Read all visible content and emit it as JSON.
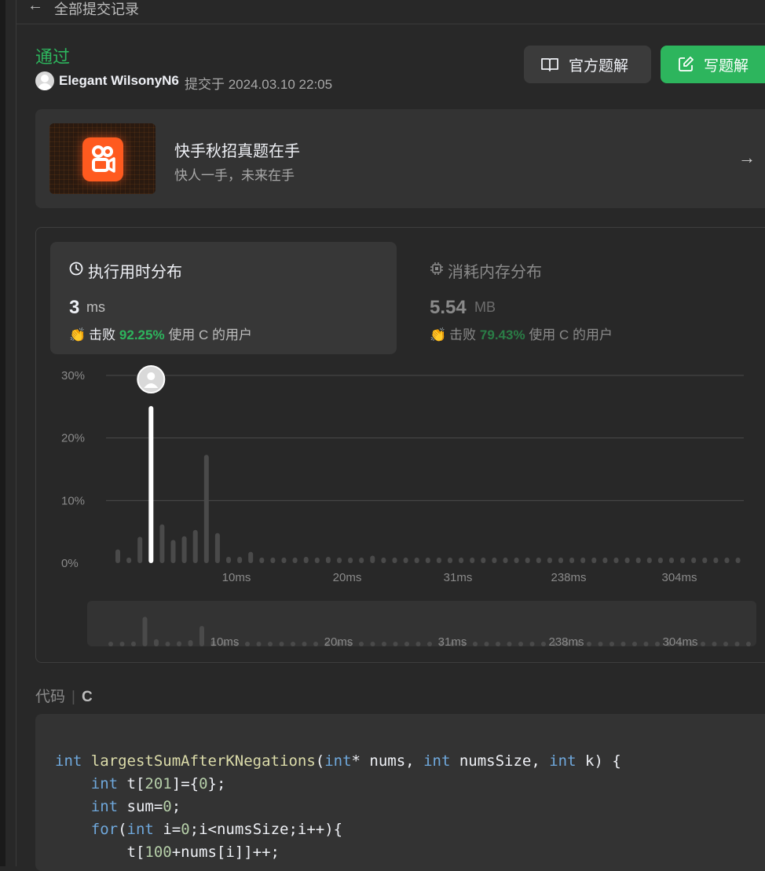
{
  "topbar": {
    "back_icon": "arrow-left-icon",
    "title": "全部提交记录"
  },
  "submission": {
    "status": "通过",
    "user": "Elegant WilsonyN6",
    "submitted_at": "提交于 2024.03.10 22:05"
  },
  "actions": {
    "official_solution": "官方题解",
    "write_solution": "写题解"
  },
  "promo": {
    "title": "快手秋招真题在手",
    "subtitle": "快人一手，未来在手"
  },
  "runtime": {
    "title": "执行用时分布",
    "value": "3",
    "unit": "ms",
    "beat_label": "击败",
    "beat_pct": "92.25%",
    "beat_suffix": "使用 C 的用户"
  },
  "memory": {
    "title": "消耗内存分布",
    "value": "5.54",
    "unit": "MB",
    "beat_label": "击败",
    "beat_pct": "79.43%",
    "beat_suffix": "使用 C 的用户"
  },
  "code_section": {
    "label": "代码",
    "language": "C"
  },
  "colors": {
    "accent": "#2db55d",
    "bar": "#4a4a4a",
    "highlight_bar": "#ffffff"
  },
  "chart_data": {
    "type": "bar",
    "title": "",
    "ylabel": "",
    "xlabel": "",
    "ylim": [
      0,
      30
    ],
    "yticks": [
      "0%",
      "10%",
      "20%",
      "30%"
    ],
    "x_tick_labels": [
      "10ms",
      "20ms",
      "31ms",
      "238ms",
      "304ms"
    ],
    "x_tick_bar_index": [
      10,
      20,
      30,
      40,
      50
    ],
    "highlight_index": 3,
    "values": [
      2.2,
      0.9,
      4.2,
      25.1,
      6.2,
      3.7,
      4.3,
      5.3,
      17.3,
      4.8,
      1.0,
      1.0,
      1.8,
      0.9,
      0.9,
      0.9,
      0.9,
      1.0,
      0.9,
      1.0,
      0.9,
      0.9,
      0.9,
      1.2,
      0.9,
      0.9,
      0.9,
      0.9,
      0.9,
      0.9,
      0.9,
      0.9,
      0.9,
      0.9,
      0.9,
      0.9,
      0.9,
      0.9,
      0.9,
      0.9,
      0.9,
      0.9,
      0.9,
      0.9,
      0.9,
      0.9,
      0.9,
      0.9,
      0.9,
      0.9,
      0.9,
      0.9,
      0.9,
      0.9,
      0.9,
      0.9,
      0.9
    ],
    "overview": {
      "x_tick_labels": [
        "10ms",
        "20ms",
        "31ms",
        "238ms",
        "304ms"
      ]
    }
  },
  "code_lines": [
    [
      [
        "kw",
        "int"
      ],
      [
        "txt",
        " "
      ],
      [
        "fn",
        "largestSumAfterKNegations"
      ],
      [
        "txt",
        "("
      ],
      [
        "kw",
        "int"
      ],
      [
        "txt",
        "* nums, "
      ],
      [
        "kw",
        "int"
      ],
      [
        "txt",
        " numsSize, "
      ],
      [
        "kw",
        "int"
      ],
      [
        "txt",
        " k) {"
      ]
    ],
    [
      [
        "txt",
        "    "
      ],
      [
        "kw",
        "int"
      ],
      [
        "txt",
        " t["
      ],
      [
        "num",
        "201"
      ],
      [
        "txt",
        "]={"
      ],
      [
        "num",
        "0"
      ],
      [
        "txt",
        "};"
      ]
    ],
    [
      [
        "txt",
        "    "
      ],
      [
        "kw",
        "int"
      ],
      [
        "txt",
        " sum="
      ],
      [
        "num",
        "0"
      ],
      [
        "txt",
        ";"
      ]
    ],
    [
      [
        "txt",
        "    "
      ],
      [
        "kw",
        "for"
      ],
      [
        "txt",
        "("
      ],
      [
        "kw",
        "int"
      ],
      [
        "txt",
        " i="
      ],
      [
        "num",
        "0"
      ],
      [
        "txt",
        ";i<numsSize;i++){"
      ]
    ],
    [
      [
        "txt",
        "        t["
      ],
      [
        "num",
        "100"
      ],
      [
        "txt",
        "+nums[i]]++;"
      ]
    ]
  ]
}
